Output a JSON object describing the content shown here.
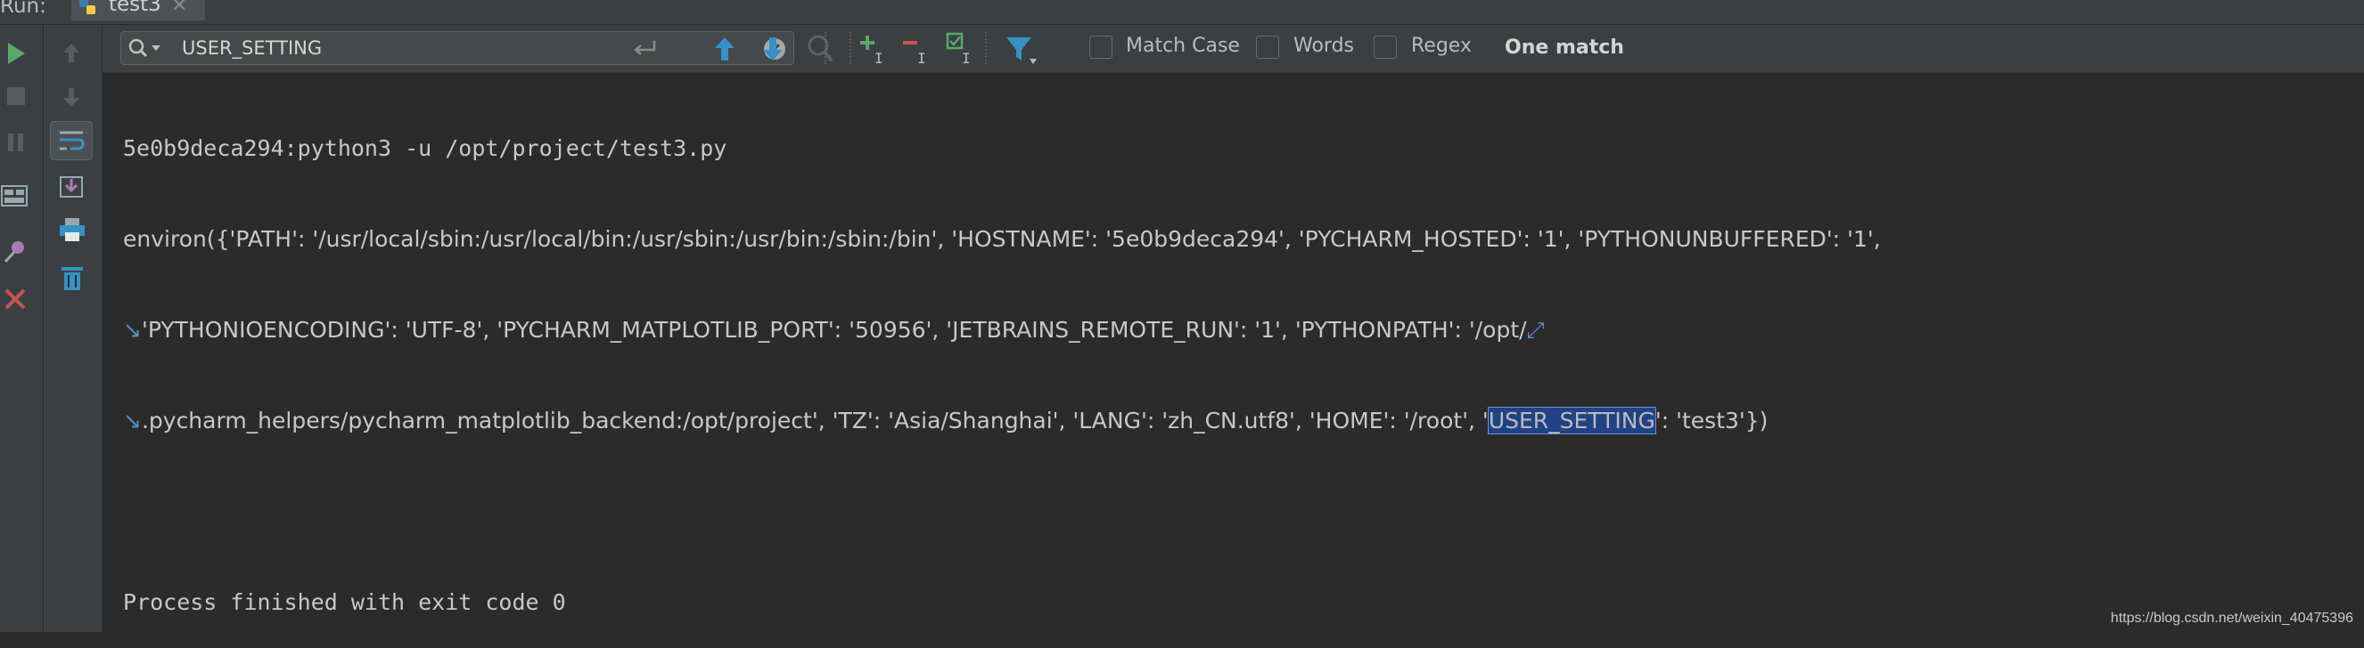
{
  "run_panel": {
    "label": "Run:",
    "tab": {
      "name": "test3",
      "icon": "python-icon"
    }
  },
  "find_bar": {
    "search_value": "USER_SETTING",
    "match_case_label": "Match Case",
    "words_label": "Words",
    "regex_label": "Regex",
    "status": "One match"
  },
  "console": {
    "line1": "5e0b9deca294:python3 -u /opt/project/test3.py",
    "line2": "environ({'PATH': '/usr/local/sbin:/usr/local/bin:/usr/sbin:/usr/bin:/sbin:/bin', 'HOSTNAME': '5e0b9deca294', 'PYCHARM_HOSTED': '1', 'PYTHONUNBUFFERED': '1', ",
    "line3": "'PYTHONIOENCODING': 'UTF-8', 'PYCHARM_MATPLOTLIB_PORT': '50956', 'JETBRAINS_REMOTE_RUN': '1', 'PYTHONPATH': '/opt/",
    "line4_before": ".pycharm_helpers/pycharm_matplotlib_backend:/opt/project', 'TZ': 'Asia/Shanghai', 'LANG': 'zh_CN.utf8', 'HOME': '/root', '",
    "line4_match": "USER_SETTING",
    "line4_after": "': 'test3'})",
    "line6": "Process finished with exit code 0"
  },
  "watermark": "https://blog.csdn.net/weixin_40475396",
  "colors": {
    "background": "#2b2b2b",
    "toolbar": "#3c3f41",
    "run_green": "#59a869",
    "arrow_blue": "#3592c4",
    "stop_red": "#c75450",
    "match_highlight": "#214283"
  }
}
